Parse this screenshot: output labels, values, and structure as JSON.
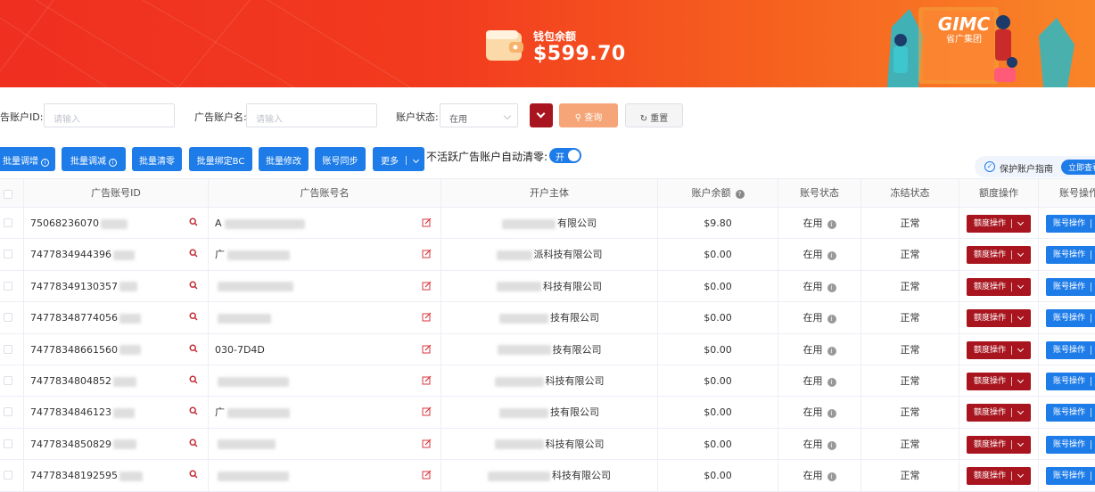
{
  "banner": {
    "balance_label": "钱包余额",
    "balance_value": "$599.70",
    "logo_name": "GIMC",
    "logo_sub": "省广集团"
  },
  "search": {
    "id_label": "告账户ID:",
    "id_placeholder": "请输入",
    "name_label": "广告账户名:",
    "name_placeholder": "请输入",
    "status_label": "账户状态:",
    "status_value": "在用",
    "query_label": "查询",
    "reset_label": "重置"
  },
  "actions": {
    "batch_increase": "批量调增",
    "batch_decrease": "批量调减",
    "batch_clear": "批量清零",
    "batch_bind_bc": "批量绑定BC",
    "batch_modify": "批量修改",
    "account_sync": "账号同步",
    "more": "更多",
    "auto_clear_label": "不活跃广告账户自动清零:",
    "toggle_text": "开",
    "guide_text": "保护账户指南",
    "guide_button": "立即查看"
  },
  "table": {
    "headers": [
      "广告账号ID",
      "广告账号名",
      "开户主体",
      "账户余额",
      "账号状态",
      "冻结状态",
      "额度操作",
      "账号操作"
    ],
    "quota_btn": "额度操作",
    "account_btn": "账号操作",
    "rows": [
      {
        "id": "75068236070",
        "name": "A",
        "company": "有限公司",
        "balance": "$9.80",
        "status": "在用",
        "freeze": "正常"
      },
      {
        "id": "7477834944396",
        "name": "广",
        "company": "派科技有限公司",
        "balance": "$0.00",
        "status": "在用",
        "freeze": "正常"
      },
      {
        "id": "74778349130357",
        "name": "",
        "company": "科技有限公司",
        "balance": "$0.00",
        "status": "在用",
        "freeze": "正常"
      },
      {
        "id": "74778348774056",
        "name": "",
        "company": "技有限公司",
        "balance": "$0.00",
        "status": "在用",
        "freeze": "正常"
      },
      {
        "id": "74778348661560",
        "name": "030-7D4D",
        "company": "技有限公司",
        "balance": "$0.00",
        "status": "在用",
        "freeze": "正常"
      },
      {
        "id": "7477834804852",
        "name": "",
        "company": "科技有限公司",
        "balance": "$0.00",
        "status": "在用",
        "freeze": "正常"
      },
      {
        "id": "7477834846123",
        "name": "广",
        "company": "技有限公司",
        "balance": "$0.00",
        "status": "在用",
        "freeze": "正常"
      },
      {
        "id": "7477834850829",
        "name": "",
        "company": "科技有限公司",
        "balance": "$0.00",
        "status": "在用",
        "freeze": "正常"
      },
      {
        "id": "74778348192595",
        "name": "",
        "company": "科技有限公司",
        "balance": "$0.00",
        "status": "在用",
        "freeze": "正常"
      }
    ]
  },
  "colors": {
    "primary": "#1e7ce8",
    "danger": "#a8151e",
    "query": "#f5a578",
    "banner_start": "#ef2f20",
    "banner_end": "#f98528"
  }
}
